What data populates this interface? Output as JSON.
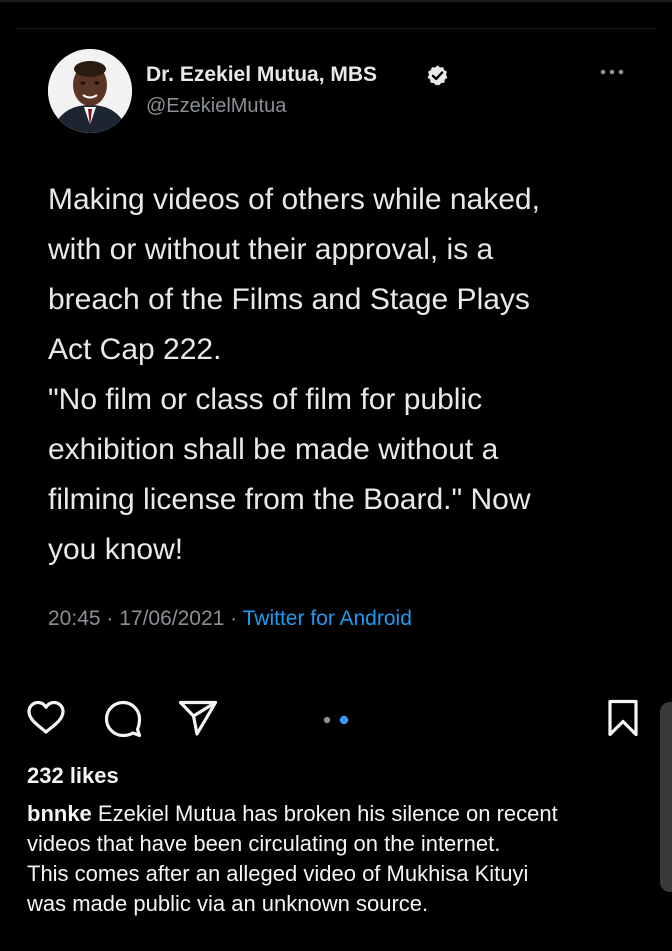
{
  "tweet": {
    "author_name": "Dr. Ezekiel Mutua, MBS",
    "handle": "@EzekielMutua",
    "text_lines": [
      "Making videos of others while naked,",
      "with or without their approval, is a",
      "breach of the Films and Stage Plays",
      "Act Cap 222.",
      "\"No film or class of film for public",
      "exhibition shall be made without a",
      "filming license from the Board.\" Now",
      "you know!"
    ],
    "time": "20:45",
    "date": "17/06/2021",
    "source": "Twitter for Android",
    "separator": " · "
  },
  "post": {
    "likes": "232 likes",
    "username": "bnnke",
    "caption_first": " Ezekiel Mutua has broken his silence on recent",
    "caption_lines": [
      "videos that have been circulating on the internet.",
      "This comes after an alleged video of Mukhisa Kituyi",
      "was made public via an unknown source."
    ],
    "carousel": {
      "count": 2,
      "active_index": 1
    }
  },
  "colors": {
    "background": "#000000",
    "text": "#e7e9ea",
    "secondary": "#8b9096",
    "link": "#1d9bf0",
    "dot_active": "#3897f0",
    "dot_inactive": "#8e8e8e"
  },
  "icons": {
    "verified": "verified-badge-icon",
    "more": "more-icon",
    "like": "heart-icon",
    "comment": "comment-icon",
    "share": "send-icon",
    "save": "bookmark-icon"
  }
}
